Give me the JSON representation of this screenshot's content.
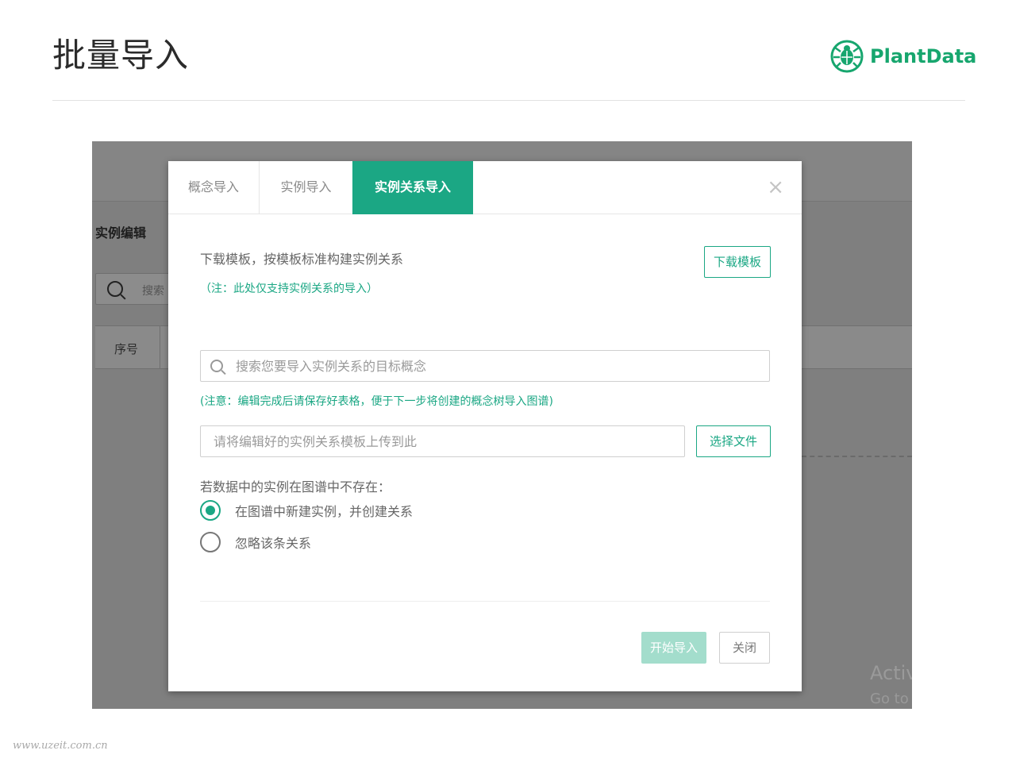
{
  "slide": {
    "title": "批量导入",
    "brand_name": "PlantData",
    "watermark": "www.uzeit.com.cn"
  },
  "background_app": {
    "section_title": "实例编辑",
    "search_placeholder": "搜索",
    "table_first_column": "序号",
    "activation_line1": "Activ",
    "activation_line2": "Go to"
  },
  "modal": {
    "tabs": [
      {
        "label": "概念导入",
        "active": false
      },
      {
        "label": "实例导入",
        "active": false
      },
      {
        "label": "实例关系导入",
        "active": true
      }
    ],
    "close_symbol": "×",
    "description": "下载模板，按模板标准构建实例关系",
    "note": "（注：此处仅支持实例关系的导入）",
    "download_button": "下载模板",
    "search_placeholder": "搜索您要导入实例关系的目标概念",
    "edit_note": "(注意：编辑完成后请保存好表格，便于下一步将创建的概念树导入图谱)",
    "upload_placeholder": "请将编辑好的实例关系模板上传到此",
    "choose_file_button": "选择文件",
    "question": "若数据中的实例在图谱中不存在：",
    "options": [
      {
        "label": "在图谱中新建实例，并创建关系",
        "checked": true
      },
      {
        "label": "忽略该条关系",
        "checked": false
      }
    ],
    "start_button": "开始导入",
    "close_button": "关闭"
  },
  "colors": {
    "accent": "#1ba784",
    "accent_disabled": "#a3ddcc",
    "overlay": "#7f7f7f"
  }
}
